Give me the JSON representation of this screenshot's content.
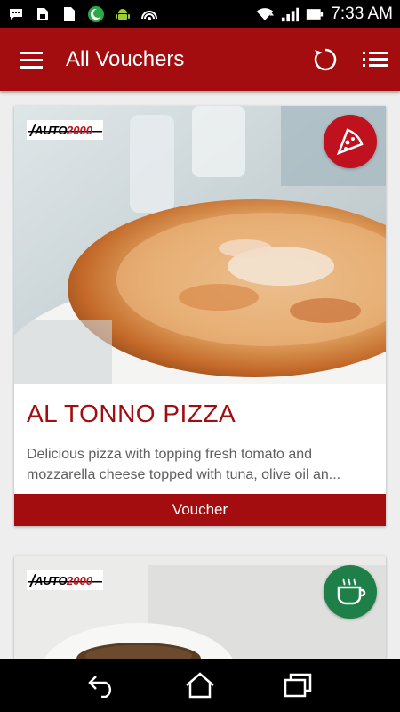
{
  "status_bar": {
    "time": "7:33 AM",
    "icons": [
      "chat-icon",
      "sim-icon",
      "file-icon",
      "ramadan-icon",
      "android-icon",
      "broadcast-icon",
      "wifi-icon",
      "signal-icon",
      "battery-icon"
    ]
  },
  "app_bar": {
    "title": "All Vouchers",
    "icons": [
      "menu-icon",
      "refresh-icon",
      "list-view-icon"
    ]
  },
  "vouchers": [
    {
      "logo": "AUTO 2000",
      "title": "AL TONNO PIZZA",
      "description": "Delicious pizza with topping fresh tomato and mozzarella cheese topped with tuna, olive oil an...",
      "button_label": "Voucher",
      "category_icon": "pizza-icon",
      "category_color": "#c0121e"
    },
    {
      "logo": "AUTO 2000",
      "category_icon": "coffee-icon",
      "category_color": "#1e8048"
    }
  ],
  "nav_bar": {
    "icons": [
      "back-icon",
      "home-icon",
      "recent-apps-icon"
    ]
  },
  "colors": {
    "primary": "#a30d10",
    "background": "#eeeeee"
  }
}
